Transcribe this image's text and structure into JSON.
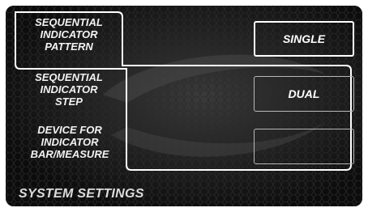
{
  "menu": [
    {
      "lines": [
        "SEQUENTIAL",
        "INDICATOR",
        "PATTERN"
      ],
      "selected": true
    },
    {
      "lines": [
        "SEQUENTIAL",
        "INDICATOR",
        "STEP"
      ],
      "selected": false
    },
    {
      "lines": [
        "DEVICE FOR",
        "INDICATOR",
        "BAR/MEASURE"
      ],
      "selected": false
    }
  ],
  "options": [
    {
      "label": "SINGLE",
      "selected": true
    },
    {
      "label": "DUAL",
      "selected": false
    },
    {
      "label": "",
      "selected": false
    }
  ],
  "footer": {
    "title": "SYSTEM SETTINGS"
  },
  "colors": {
    "screen_bg": "#0c0c0c",
    "text": "#f2f2f2",
    "outline": "#ffffff",
    "inactive_box": "#b8b8b8"
  }
}
